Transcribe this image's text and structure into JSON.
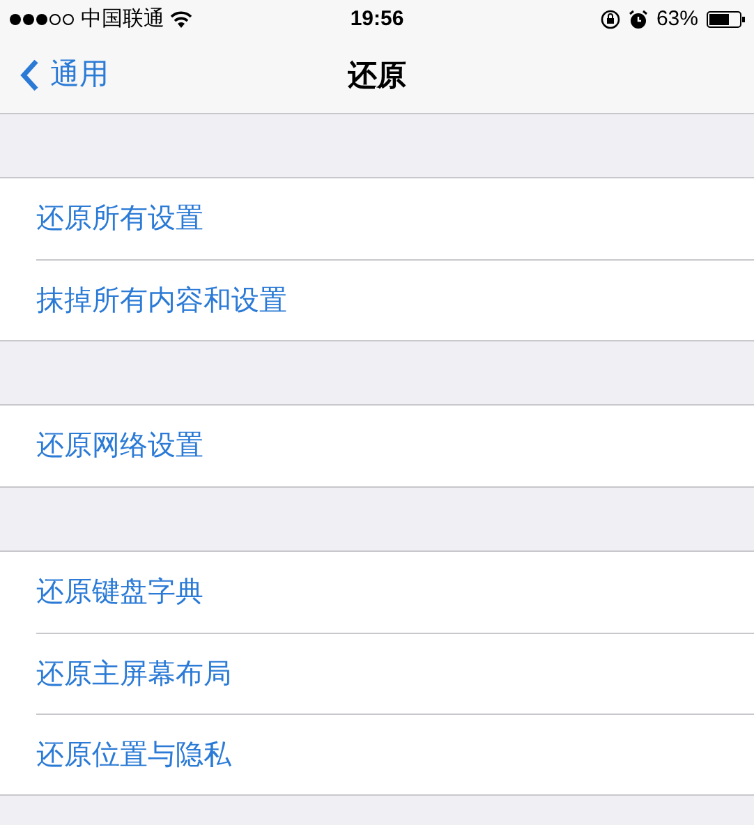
{
  "status_bar": {
    "carrier": "中国联通",
    "time": "19:56",
    "battery": "63%"
  },
  "nav": {
    "back": "通用",
    "title": "还原"
  },
  "groups": [
    {
      "items": [
        "还原所有设置",
        "抹掉所有内容和设置"
      ]
    },
    {
      "items": [
        "还原网络设置"
      ]
    },
    {
      "items": [
        "还原键盘字典",
        "还原主屏幕布局",
        "还原位置与隐私"
      ]
    }
  ]
}
